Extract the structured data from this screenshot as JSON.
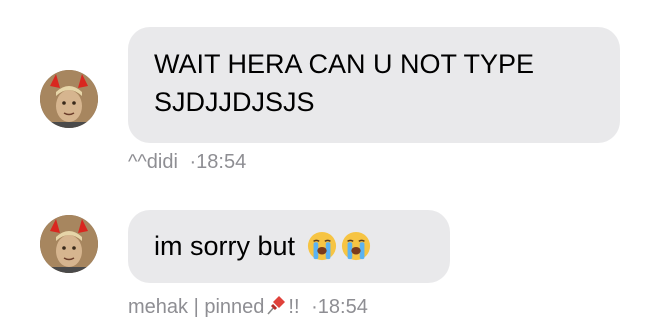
{
  "messages": [
    {
      "lines": [
        "WAIT HERA CAN U NOT TYPE",
        "SJDJJDJSJS"
      ],
      "sender": "^^didi",
      "separator": "·",
      "time": "18:54",
      "avatar_icon": "devil-horns-avatar"
    },
    {
      "text": "im sorry but",
      "emojis": [
        "loudly-crying-face-icon",
        "loudly-crying-face-icon"
      ],
      "sender": "mehak | pinned",
      "sender_suffix_icon": "pushpin-icon",
      "sender_suffix": "!!",
      "separator": "·",
      "time": "18:54",
      "avatar_icon": "devil-horns-avatar"
    }
  ],
  "colors": {
    "bubble": "#e9e9eb",
    "meta_text": "#8e8e93",
    "text": "#000000"
  }
}
